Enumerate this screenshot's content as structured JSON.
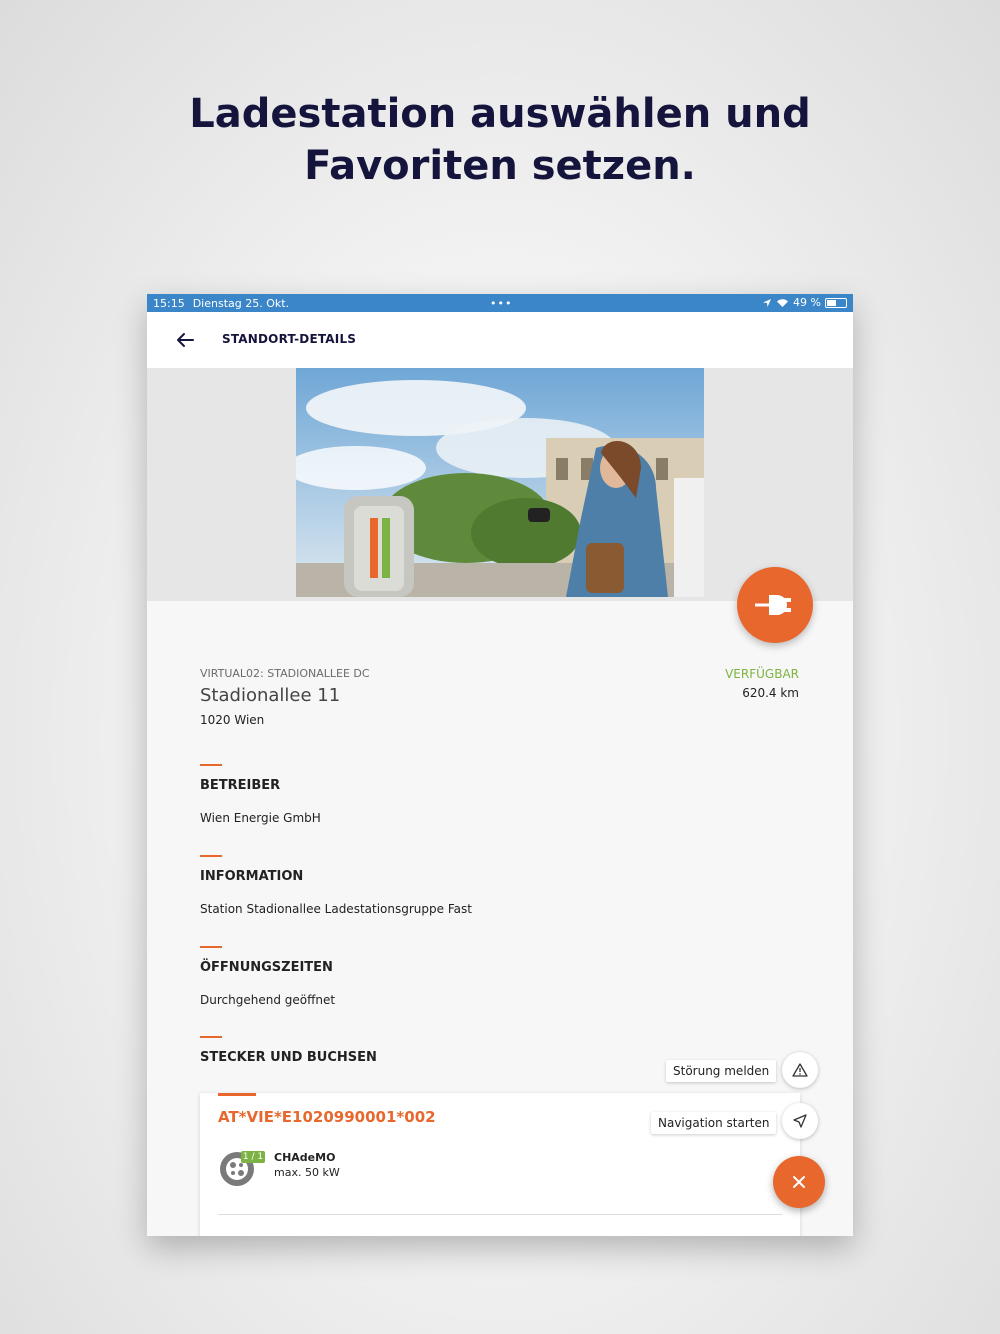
{
  "headline": {
    "line1": "Ladestation auswählen und",
    "line2": "Favoriten setzen."
  },
  "statusbar": {
    "time": "15:15",
    "date": "Dienstag 25. Okt.",
    "battery": "49 %"
  },
  "appbar": {
    "title": "STANDORT-DETAILS"
  },
  "location": {
    "id": "VIRTUAL02: STADIONALLEE DC",
    "street": "Stadionallee 11",
    "city": "1020 Wien",
    "status": "VERFÜGBAR",
    "distance": "620.4 km"
  },
  "sections": [
    {
      "label": "BETREIBER",
      "value": "Wien Energie GmbH"
    },
    {
      "label": "INFORMATION",
      "value": "Station Stadionallee Ladestationsgruppe Fast"
    },
    {
      "label": "ÖFFNUNGSZEITEN",
      "value": "Durchgehend geöffnet"
    },
    {
      "label": "STECKER UND BUCHSEN",
      "value": ""
    }
  ],
  "evse_card": {
    "id": "AT*VIE*E1020990001*002",
    "count": "1 / 1",
    "connector_name": "CHAdeMO",
    "connector_power": "max. 50 kW"
  },
  "speed_dial": {
    "report": "Störung melden",
    "navigate": "Navigation starten"
  },
  "colors": {
    "accent": "#e8672c",
    "available": "#7cb342",
    "headline": "#14143c",
    "statusbar": "#3a86c8"
  }
}
